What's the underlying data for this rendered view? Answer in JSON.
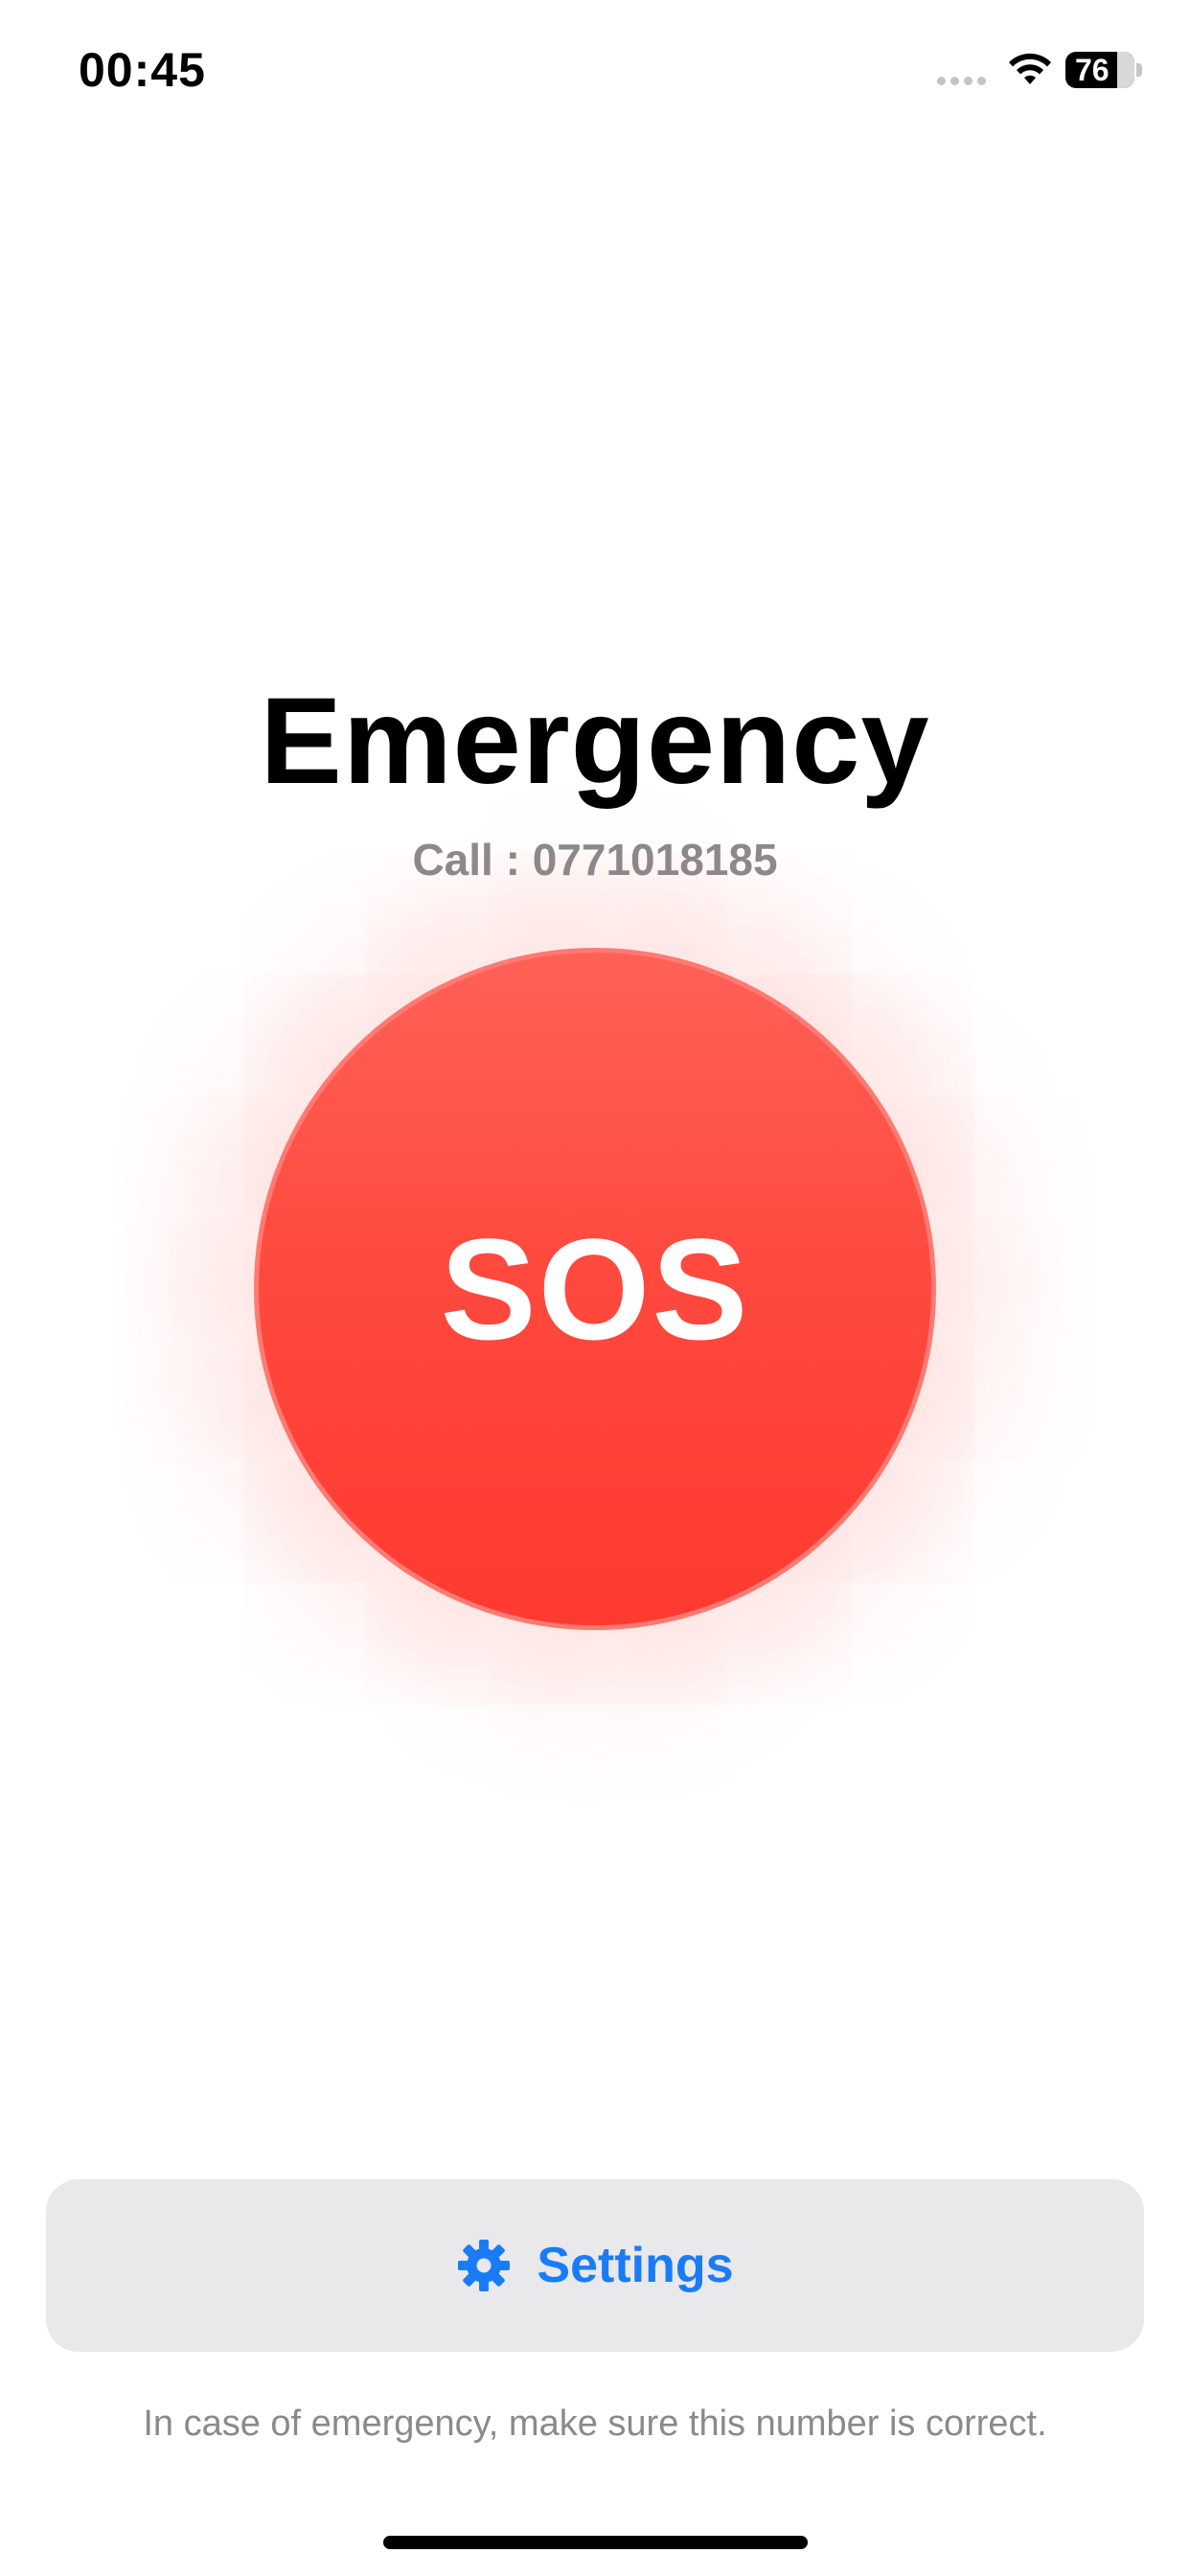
{
  "status_bar": {
    "time": "00:45",
    "battery_level": "76",
    "icons": [
      "signal-icon",
      "wifi-icon",
      "battery-icon"
    ]
  },
  "main": {
    "title": "Emergency",
    "call_text": "Call : 0771018185",
    "sos_label": "SOS",
    "sos_color": "#ff3b30"
  },
  "settings": {
    "label": "Settings",
    "icon": "gear-icon",
    "accent_color": "#1a7cf5"
  },
  "footer": {
    "note": "In case of emergency, make sure this number is correct."
  }
}
